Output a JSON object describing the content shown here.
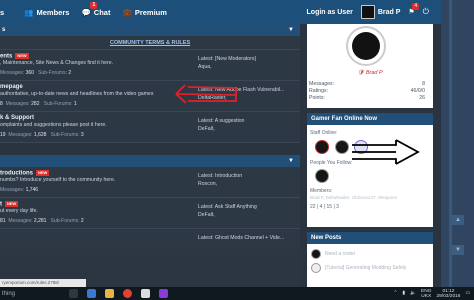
{
  "nav": {
    "left_fragment": "s",
    "members": "Members",
    "chat": "Chat",
    "chat_badge": "1",
    "premium": "Premium",
    "login_as_user": "Login as User",
    "username": "Brad P",
    "alerts_badge": "4"
  },
  "main": {
    "panel1_title": "s",
    "terms_link": "COMMUNITY TERMS & RULES",
    "forums": [
      {
        "title": "ents",
        "new": "NEW",
        "desc": ", Maintenance, Site News & Changes find it here.",
        "stats_label1": "Messages:",
        "stats_val1": "360",
        "stats_label2": "Sub-Forums:",
        "stats_val2": "2",
        "latest_title": "Latest: [New Moderators]",
        "latest_user": "Aqua,"
      },
      {
        "title": "mepage",
        "new": "",
        "desc": "authoritative, up-to-date news and headlines from the video games",
        "stats_prefix": "8",
        "stats_label1": "Messages:",
        "stats_val1": "282",
        "stats_label2": "Sub-Forums:",
        "stats_val2": "1",
        "latest_title": "Latest: New Adobe Flash Vulnerabil...",
        "latest_user": "DeltaRaider,"
      },
      {
        "title": "k & Support",
        "new": "",
        "desc": "omplaints and suggestions please post it here.",
        "stats_prefix": "19",
        "stats_label1": "Messages:",
        "stats_val1": "1,628",
        "stats_label2": "Sub-Forums:",
        "stats_val2": "3",
        "latest_title": "Latest: A suggestion",
        "latest_user": "DeFalt,"
      }
    ],
    "panel2_title": "",
    "forums2": [
      {
        "title": "troductions",
        "new": "NEW",
        "desc": "numbs? Introduce yourself to the community here.",
        "stats_label1": "Messages:",
        "stats_val1": "1,746",
        "latest_title": "Latest: Introduction",
        "latest_user": "Roxcon,"
      },
      {
        "title": "t",
        "new": "NEW",
        "desc": "ut every day life.",
        "stats_prefix": "81",
        "stats_label1": "Messages:",
        "stats_val1": "2,281",
        "stats_label2": "Sub-Forums:",
        "stats_val2": "2",
        "latest_title": "Latest: Ask Staff Anything",
        "latest_user": "DeFalt,"
      },
      {
        "title": "",
        "new": "",
        "desc": "",
        "latest_title": "Latest: Ghost Mods Channel + Vide...",
        "latest_user": ""
      }
    ],
    "tooltip": "ryemporium.com/rules.2788/"
  },
  "sidebar": {
    "profile_name": "Brad P",
    "messages_label": "Messages:",
    "messages_val": "8",
    "ratings_label": "Ratings:",
    "ratings_val": "46/0/0",
    "points_label": "Points:",
    "points_val": "26",
    "fan_title": "Gamer Fan Online Now",
    "staff_online": "Staff Online:",
    "people_follow": "People You Follow:",
    "members_label": "Members:",
    "members_list": "Brad P, DeltaRaider, Oblivion247, Weapons",
    "counts": "22 | 4 | 15 | 3",
    "new_posts_title": "New Posts",
    "post1": "Need a roster",
    "post2": "[Tutorial] Generating Modding Safely"
  },
  "taskbar": {
    "search": "thing",
    "lang": "ENG",
    "region": "UKX",
    "time": "01:12",
    "date": "29/03/2016"
  }
}
